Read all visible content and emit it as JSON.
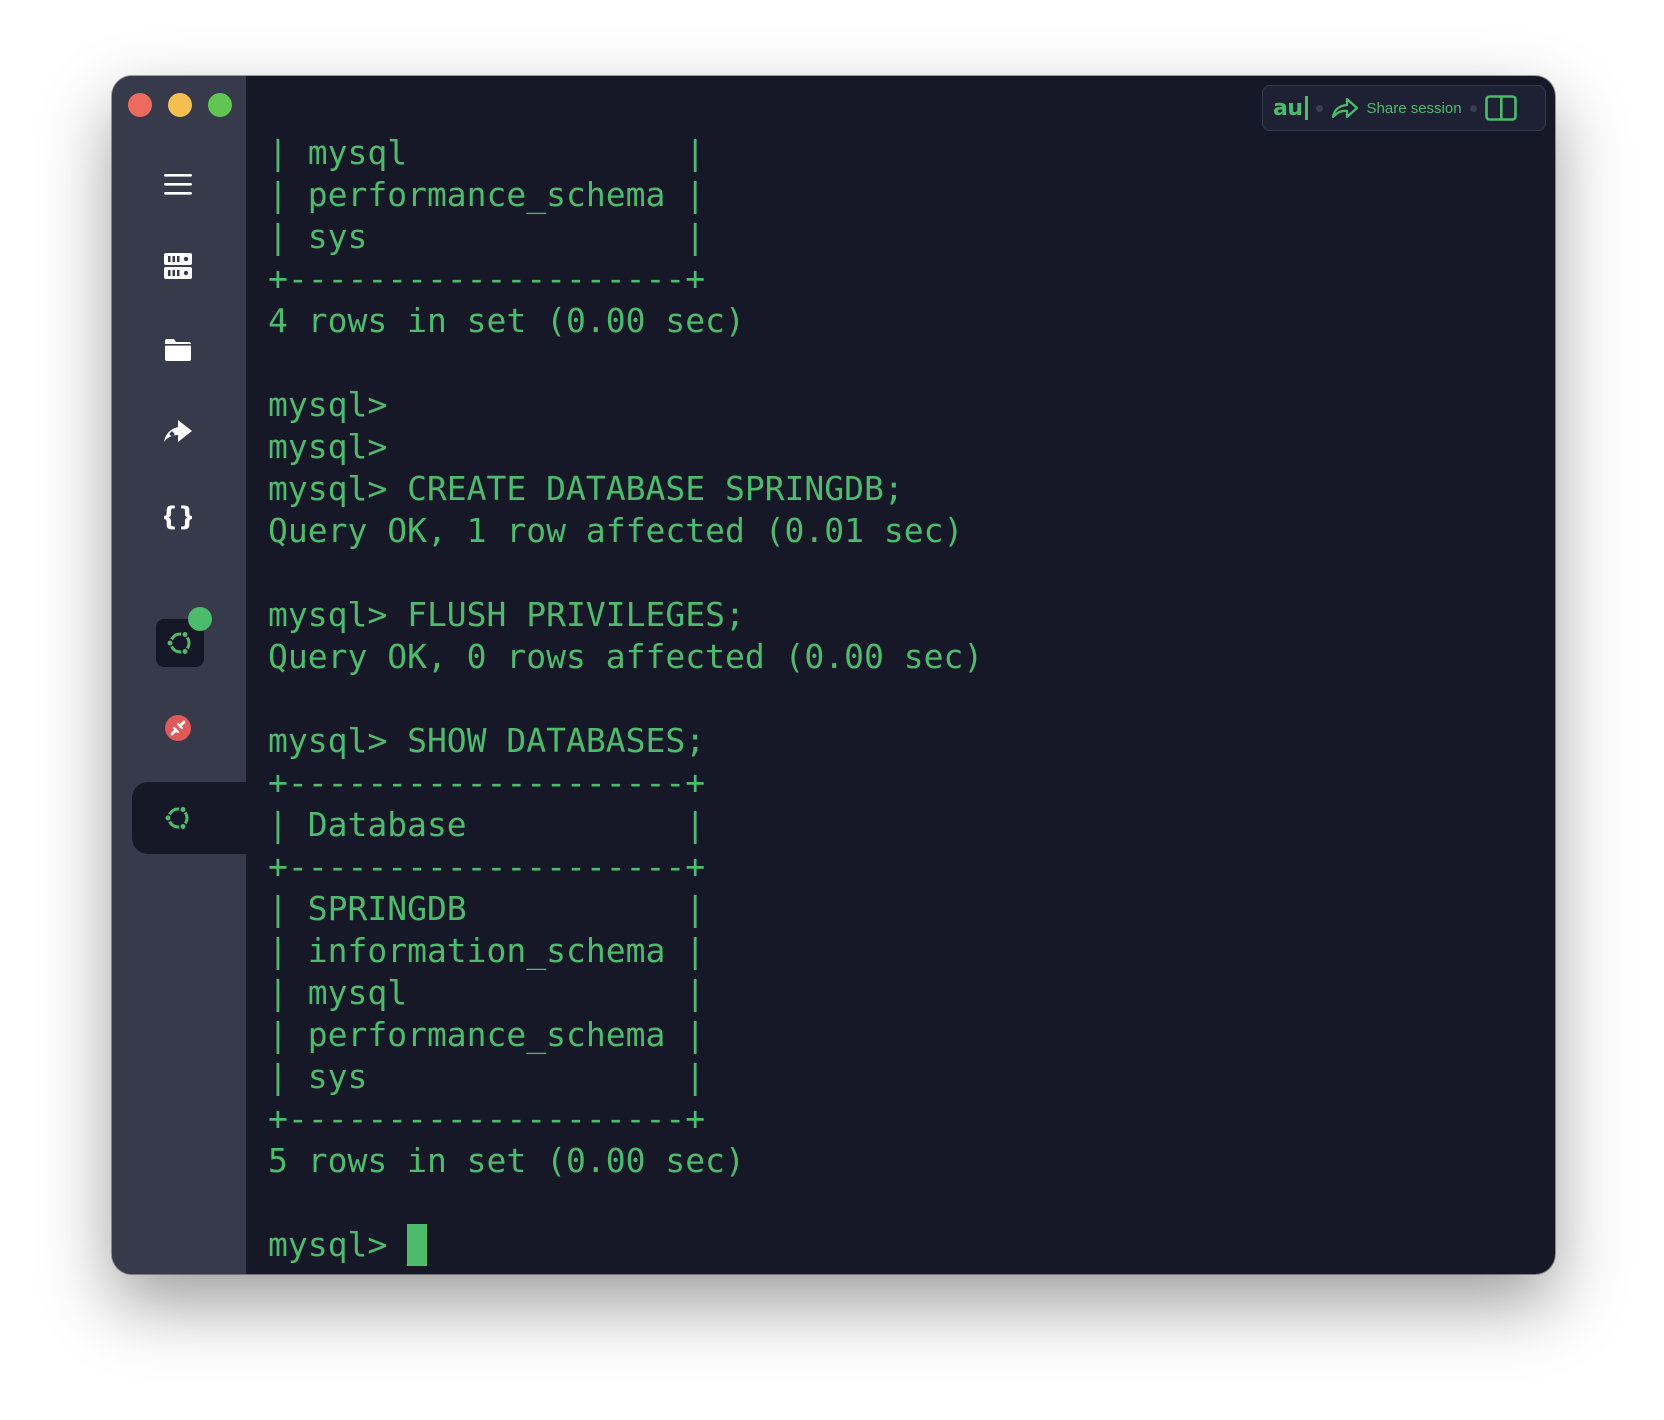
{
  "window": {
    "sidebar": {
      "items": [
        {
          "name": "menu",
          "icon": "hamburger-menu-icon"
        },
        {
          "name": "hosts",
          "icon": "server-icon"
        },
        {
          "name": "files",
          "icon": "folder-icon"
        },
        {
          "name": "port-forwarding",
          "icon": "forward-arrow-icon"
        },
        {
          "name": "snippets",
          "icon": "curly-braces-icon"
        },
        {
          "name": "ubuntu-host",
          "icon": "ubuntu-icon",
          "status": "connected"
        },
        {
          "name": "disconnected-host",
          "icon": "disconnected-icon"
        },
        {
          "name": "active-session",
          "icon": "ubuntu-icon"
        }
      ]
    },
    "toolbar": {
      "autocomplete_label": "au",
      "share_label": "Share session",
      "split_icon": "split-view-icon"
    }
  },
  "terminal": {
    "lines": [
      "| mysql              |",
      "| performance_schema |",
      "| sys                |",
      "+--------------------+",
      "4 rows in set (0.00 sec)",
      "",
      "mysql>",
      "mysql>",
      "mysql> CREATE DATABASE SPRINGDB;",
      "Query OK, 1 row affected (0.01 sec)",
      "",
      "mysql> FLUSH PRIVILEGES;",
      "Query OK, 0 rows affected (0.00 sec)",
      "",
      "mysql> SHOW DATABASES;",
      "+--------------------+",
      "| Database           |",
      "+--------------------+",
      "| SPRINGDB           |",
      "| information_schema |",
      "| mysql              |",
      "| performance_schema |",
      "| sys                |",
      "+--------------------+",
      "5 rows in set (0.00 sec)",
      ""
    ],
    "prompt": "mysql> "
  },
  "colors": {
    "terminal_bg": "#161828",
    "sidebar_bg": "#373a4a",
    "text_green": "#4dbb6c",
    "error_red": "#e05a5a"
  }
}
